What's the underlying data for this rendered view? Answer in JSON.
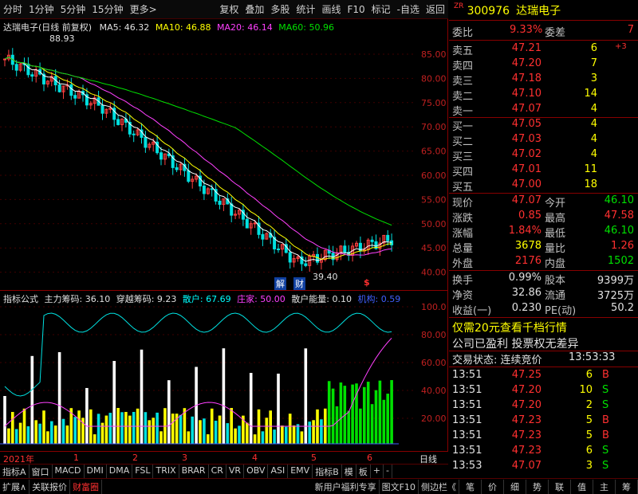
{
  "toolbar": {
    "left_items": [
      "分时",
      "1分钟",
      "5分钟",
      "15分钟",
      "更多>"
    ],
    "right_items": [
      "复权",
      "叠加",
      "多股",
      "统计",
      "画线",
      "F10",
      "标记",
      "-自选",
      "返回"
    ]
  },
  "main_chart": {
    "title": "达瑞电子(日线 前复权)",
    "ma5": "MA5: 46.32",
    "ma10": "MA10: 46.88",
    "ma20": "MA20: 46.14",
    "ma60": "MA60: 50.96",
    "high_label": "88.93",
    "low_label": "39.40",
    "marker1": "解",
    "marker2": "财",
    "marker3": "$",
    "y_ticks": [
      "85.00",
      "80.00",
      "75.00",
      "70.00",
      "65.00",
      "60.00",
      "55.00",
      "50.00",
      "45.00",
      "40.00"
    ]
  },
  "sub_chart": {
    "title": "指标公式",
    "zhuli": "主力筹码: 36.10",
    "chuanyue": "穿越筹码: 9.23",
    "sanhu": "散户: 67.69",
    "zhuangjia": "庄家: 50.00",
    "sanhu_energy": "散户能量: 0.10",
    "jigou": "机构: 0.59",
    "y_ticks": [
      "100.0",
      "80.00",
      "60.00",
      "40.00",
      "20.00"
    ]
  },
  "date_axis": {
    "year": "2021年",
    "months": [
      "1",
      "2",
      "3",
      "4",
      "5",
      "6"
    ],
    "right_label": "日线"
  },
  "bottom_tabs1": [
    "指标A",
    "窗口",
    "MACD",
    "DMI",
    "DMA",
    "FSL",
    "TRIX",
    "BRAR",
    "CR",
    "VR",
    "OBV",
    "ASI",
    "EMV",
    "指标B",
    "模",
    "板",
    "+",
    "-"
  ],
  "bottom_tabs2": {
    "left": [
      "扩展∧",
      "关联报价",
      "财富圈"
    ],
    "middle": [
      "新用户福利专享",
      "图文F10",
      "侧边栏《"
    ],
    "right": [
      "笔",
      "价",
      "细",
      "势",
      "联",
      "值",
      "主",
      "筹"
    ]
  },
  "stock": {
    "badge": "ZR",
    "code": "300976",
    "name": "达瑞电子"
  },
  "order_book": {
    "weibi_label": "委比",
    "weibi_value": "9.33%",
    "weicha_label": "委差",
    "weicha_value": "7",
    "sells": [
      {
        "label": "卖五",
        "price": "47.21",
        "vol": "6",
        "extra": "+3"
      },
      {
        "label": "卖四",
        "price": "47.20",
        "vol": "7",
        "extra": ""
      },
      {
        "label": "卖三",
        "price": "47.18",
        "vol": "3",
        "extra": ""
      },
      {
        "label": "卖二",
        "price": "47.10",
        "vol": "14",
        "extra": ""
      },
      {
        "label": "卖一",
        "price": "47.07",
        "vol": "4",
        "extra": ""
      }
    ],
    "buys": [
      {
        "label": "买一",
        "price": "47.05",
        "vol": "4"
      },
      {
        "label": "买二",
        "price": "47.03",
        "vol": "4"
      },
      {
        "label": "买三",
        "price": "47.02",
        "vol": "4"
      },
      {
        "label": "买四",
        "price": "47.01",
        "vol": "11"
      },
      {
        "label": "买五",
        "price": "47.00",
        "vol": "18"
      }
    ]
  },
  "quote": [
    {
      "l1": "现价",
      "v1": "47.07",
      "c1": "red",
      "l2": "今开",
      "v2": "46.10",
      "c2": "green"
    },
    {
      "l1": "涨跌",
      "v1": "0.85",
      "c1": "red",
      "l2": "最高",
      "v2": "47.58",
      "c2": "red"
    },
    {
      "l1": "涨幅",
      "v1": "1.84%",
      "c1": "red",
      "l2": "最低",
      "v2": "46.10",
      "c2": "green"
    },
    {
      "l1": "总量",
      "v1": "3678",
      "c1": "yellow",
      "l2": "量比",
      "v2": "1.26",
      "c2": "red"
    },
    {
      "l1": "外盘",
      "v1": "2176",
      "c1": "red",
      "l2": "内盘",
      "v2": "1502",
      "c2": "green"
    }
  ],
  "fundamentals": [
    {
      "l1": "换手",
      "v1": "0.99%",
      "l2": "股本",
      "v2": "9399万"
    },
    {
      "l1": "净资",
      "v1": "32.86",
      "l2": "流通",
      "v2": "3725万"
    },
    {
      "l1": "收益(一)",
      "v1": "0.230",
      "l2": "PE(动)",
      "v2": "50.2"
    }
  ],
  "promo": "仅需20元查看千档行情",
  "notice": "公司已盈利 投票权无差异",
  "trade_status": {
    "label": "交易状态: 连续竞价",
    "time": "13:53:33"
  },
  "ticks": [
    {
      "time": "13:51",
      "price": "47.25",
      "vol": "6",
      "side": "B"
    },
    {
      "time": "13:51",
      "price": "47.20",
      "vol": "10",
      "side": "S"
    },
    {
      "time": "13:51",
      "price": "47.20",
      "vol": "2",
      "side": "S"
    },
    {
      "time": "13:51",
      "price": "47.23",
      "vol": "5",
      "side": "B"
    },
    {
      "time": "13:51",
      "price": "47.23",
      "vol": "5",
      "side": "B"
    },
    {
      "time": "13:51",
      "price": "47.23",
      "vol": "6",
      "side": "S"
    },
    {
      "time": "13:53",
      "price": "47.07",
      "vol": "3",
      "side": "S"
    }
  ],
  "colors": {
    "up": "#ff3030",
    "down": "#00e000",
    "accent": "#ffff00",
    "frame": "#880000"
  }
}
